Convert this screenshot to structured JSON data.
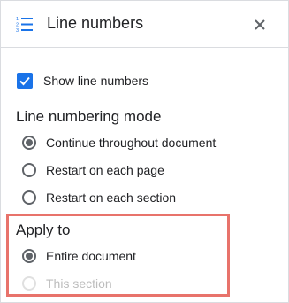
{
  "header": {
    "title": "Line numbers",
    "icon": "line-numbers-icon",
    "close_icon": "close-icon"
  },
  "show_line_numbers": {
    "label": "Show line numbers",
    "checked": true
  },
  "mode": {
    "title": "Line numbering mode",
    "options": [
      {
        "label": "Continue throughout document",
        "selected": true
      },
      {
        "label": "Restart on each page",
        "selected": false
      },
      {
        "label": "Restart on each section",
        "selected": false
      }
    ]
  },
  "apply_to": {
    "title": "Apply to",
    "options": [
      {
        "label": "Entire document",
        "selected": true,
        "disabled": false
      },
      {
        "label": "This section",
        "selected": false,
        "disabled": true
      }
    ]
  },
  "colors": {
    "accent": "#1a73e8",
    "highlight": "#e8736b"
  }
}
